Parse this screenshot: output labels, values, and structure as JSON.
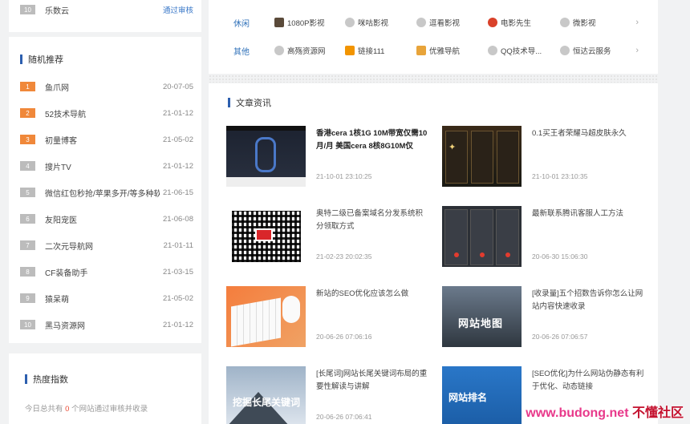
{
  "top_item": {
    "rank": "10",
    "name": "乐数云",
    "status": "通过审核"
  },
  "random": {
    "title": "随机推荐",
    "items": [
      {
        "rank": "1",
        "name": "鱼爪网",
        "date": "20-07-05"
      },
      {
        "rank": "2",
        "name": "52技术导航",
        "date": "21-01-12"
      },
      {
        "rank": "3",
        "name": "初量博客",
        "date": "21-05-02"
      },
      {
        "rank": "4",
        "name": "搜片TV",
        "date": "21-01-12"
      },
      {
        "rank": "5",
        "name": "微信红包秒抢/苹果多开/等多种软件",
        "date": "21-06-15"
      },
      {
        "rank": "6",
        "name": "友阳宠医",
        "date": "21-06-08"
      },
      {
        "rank": "7",
        "name": "二次元导航网",
        "date": "21-01-11"
      },
      {
        "rank": "8",
        "name": "CF装备助手",
        "date": "21-03-15"
      },
      {
        "rank": "9",
        "name": "猿呆萌",
        "date": "21-05-02"
      },
      {
        "rank": "10",
        "name": "黑马资源网",
        "date": "21-01-12"
      }
    ]
  },
  "hot": {
    "title": "热度指数",
    "desc_prefix": "今日总共有",
    "count": "0",
    "desc_suffix": "个网站通过审核并收录"
  },
  "nav_rows": [
    {
      "category": "休闲",
      "items": [
        "1080P影视",
        "咪咕影视",
        "逗看影视",
        "电影先生",
        "微影视"
      ]
    },
    {
      "category": "其他",
      "items": [
        "高殇资源网",
        "链接111",
        "优雅导航",
        "QQ技术导...",
        "恒达云服务"
      ]
    }
  ],
  "articles": {
    "title": "文章资讯",
    "items": [
      {
        "title": "香港cera 1核1G 10M带宽仅需10月/月 美国cera 8核8G10M仅",
        "date": "21-10-01 23:10:25"
      },
      {
        "title": "0.1买王者荣耀马超皮肤永久",
        "date": "21-10-01 23:10:35"
      },
      {
        "title": "奥特二级已备案域名分发系统积分领取方式",
        "date": "21-02-23 20:02:35"
      },
      {
        "title": "最新联系腾讯客服人工方法",
        "date": "20-06-30 15:06:30"
      },
      {
        "title": "新站的SEO优化应该怎么做",
        "date": "20-06-26 07:06:16"
      },
      {
        "title": "[收录量]五个招数告诉你怎么让网站内容快速收录",
        "date": "20-06-26 07:06:57"
      },
      {
        "title": "[长尾词]网站长尾关键词布局的重要性解读与讲解",
        "date": "20-06-26 07:06:41"
      },
      {
        "title": "[SEO优化]为什么网站伪静态有利于优化、动态链接",
        "date": ""
      }
    ]
  },
  "thumb_texts": {
    "map": "网站地图",
    "longtail": "挖掘长尾关键词",
    "rank": "网站排名"
  },
  "watermark": {
    "url": "www.budong.net",
    "cn": "不懂社区"
  }
}
